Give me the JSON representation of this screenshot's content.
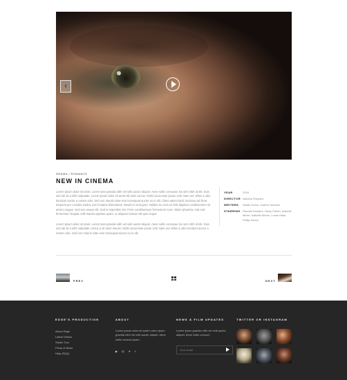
{
  "hero": {
    "prev_icon": "chevron-left-icon",
    "play_icon": "play-icon"
  },
  "post": {
    "category": "Drama / Romance",
    "title": "NEW IN CINEMA",
    "paragraph1": "Lorem ipsum dolor sit amet. Lorem Ipsn gravida nibh vel velit auctor aliquet. Aene sollic consuvae los sem nibh id elit. Duis sed odi sit a nibh vulputate. Lorem ipsum dolor sit amet elit rode cursus. Morbi accumsan ipsum velit. Nam nec tellus a odio tincidunt auctor a ornare odio. Sed non mauris vitae erat consequat auctor eu in elit. Class aptent taciti sociosqu ad litora torquent per conubia nostra, per inceptos himenaeos. Mauris in erat justo. Nullam ac urna eu felis dapibus condimentum sit amet a augue. Sed non neque elit. Sed ut imperdiet nisi. Proin condimentum fermentum nunc. Etiam pharetra, erat sed fermentum feugiat, velit mauris egestas quam, ut aliquam massa nisl quis neque.",
    "paragraph2": "Lorem ipsum dolor sit amet. Lorem Ipsn gravida nibh vel velit auctor aliquet. Aene sollic consuvae los sem nibh id elit. Duis sed odi sit a nibh vulputate cursus a sit amet mauris. Morbi accumsan ipsum velit. Nam nec tellus a odio tincidunt auctor a ornare odio. Sed non mauris vitae erat consequat auctor eu in elit.",
    "meta": [
      {
        "key": "Year",
        "value": "2018"
      },
      {
        "key": "Director",
        "value": "Isabella Shepard"
      },
      {
        "key": "Writers",
        "value": "Walter Dolan, Justine Hendern"
      },
      {
        "key": "Starring",
        "value": "Randall Sanders, Hilary Parker, Isabelle Minke, Isabella Morse, Lucas Haas, Phillip Simon"
      }
    ]
  },
  "nav": {
    "prev_label": "Prev",
    "next_label": "Next",
    "grid_icon": "grid-icon"
  },
  "footer": {
    "col1": {
      "title": "Edge's Production",
      "links": [
        "About Edge",
        "Latest Videos",
        "Studio Tour",
        "Press & News",
        "Help (FAQ)"
      ]
    },
    "col2": {
      "title": "About",
      "text": "Lorem ipsum dolor sit amet Lorem Ipsen gravida nibh vel velit auctor aliquet. Aene sollic consuvi quam.",
      "social_icons": [
        "youtube-icon",
        "instagram-icon",
        "twitter-icon",
        "facebook-icon"
      ]
    },
    "col3": {
      "title": "News & Film Updates",
      "text": "Lorem Ipsen gravida nibh vel velit auctor aliquet. Aene sollic consuvi.",
      "email_placeholder": "Your email",
      "send_icon": "send-icon"
    },
    "col4": {
      "title": "Twitter or Instagram",
      "thumbs": 6
    }
  }
}
